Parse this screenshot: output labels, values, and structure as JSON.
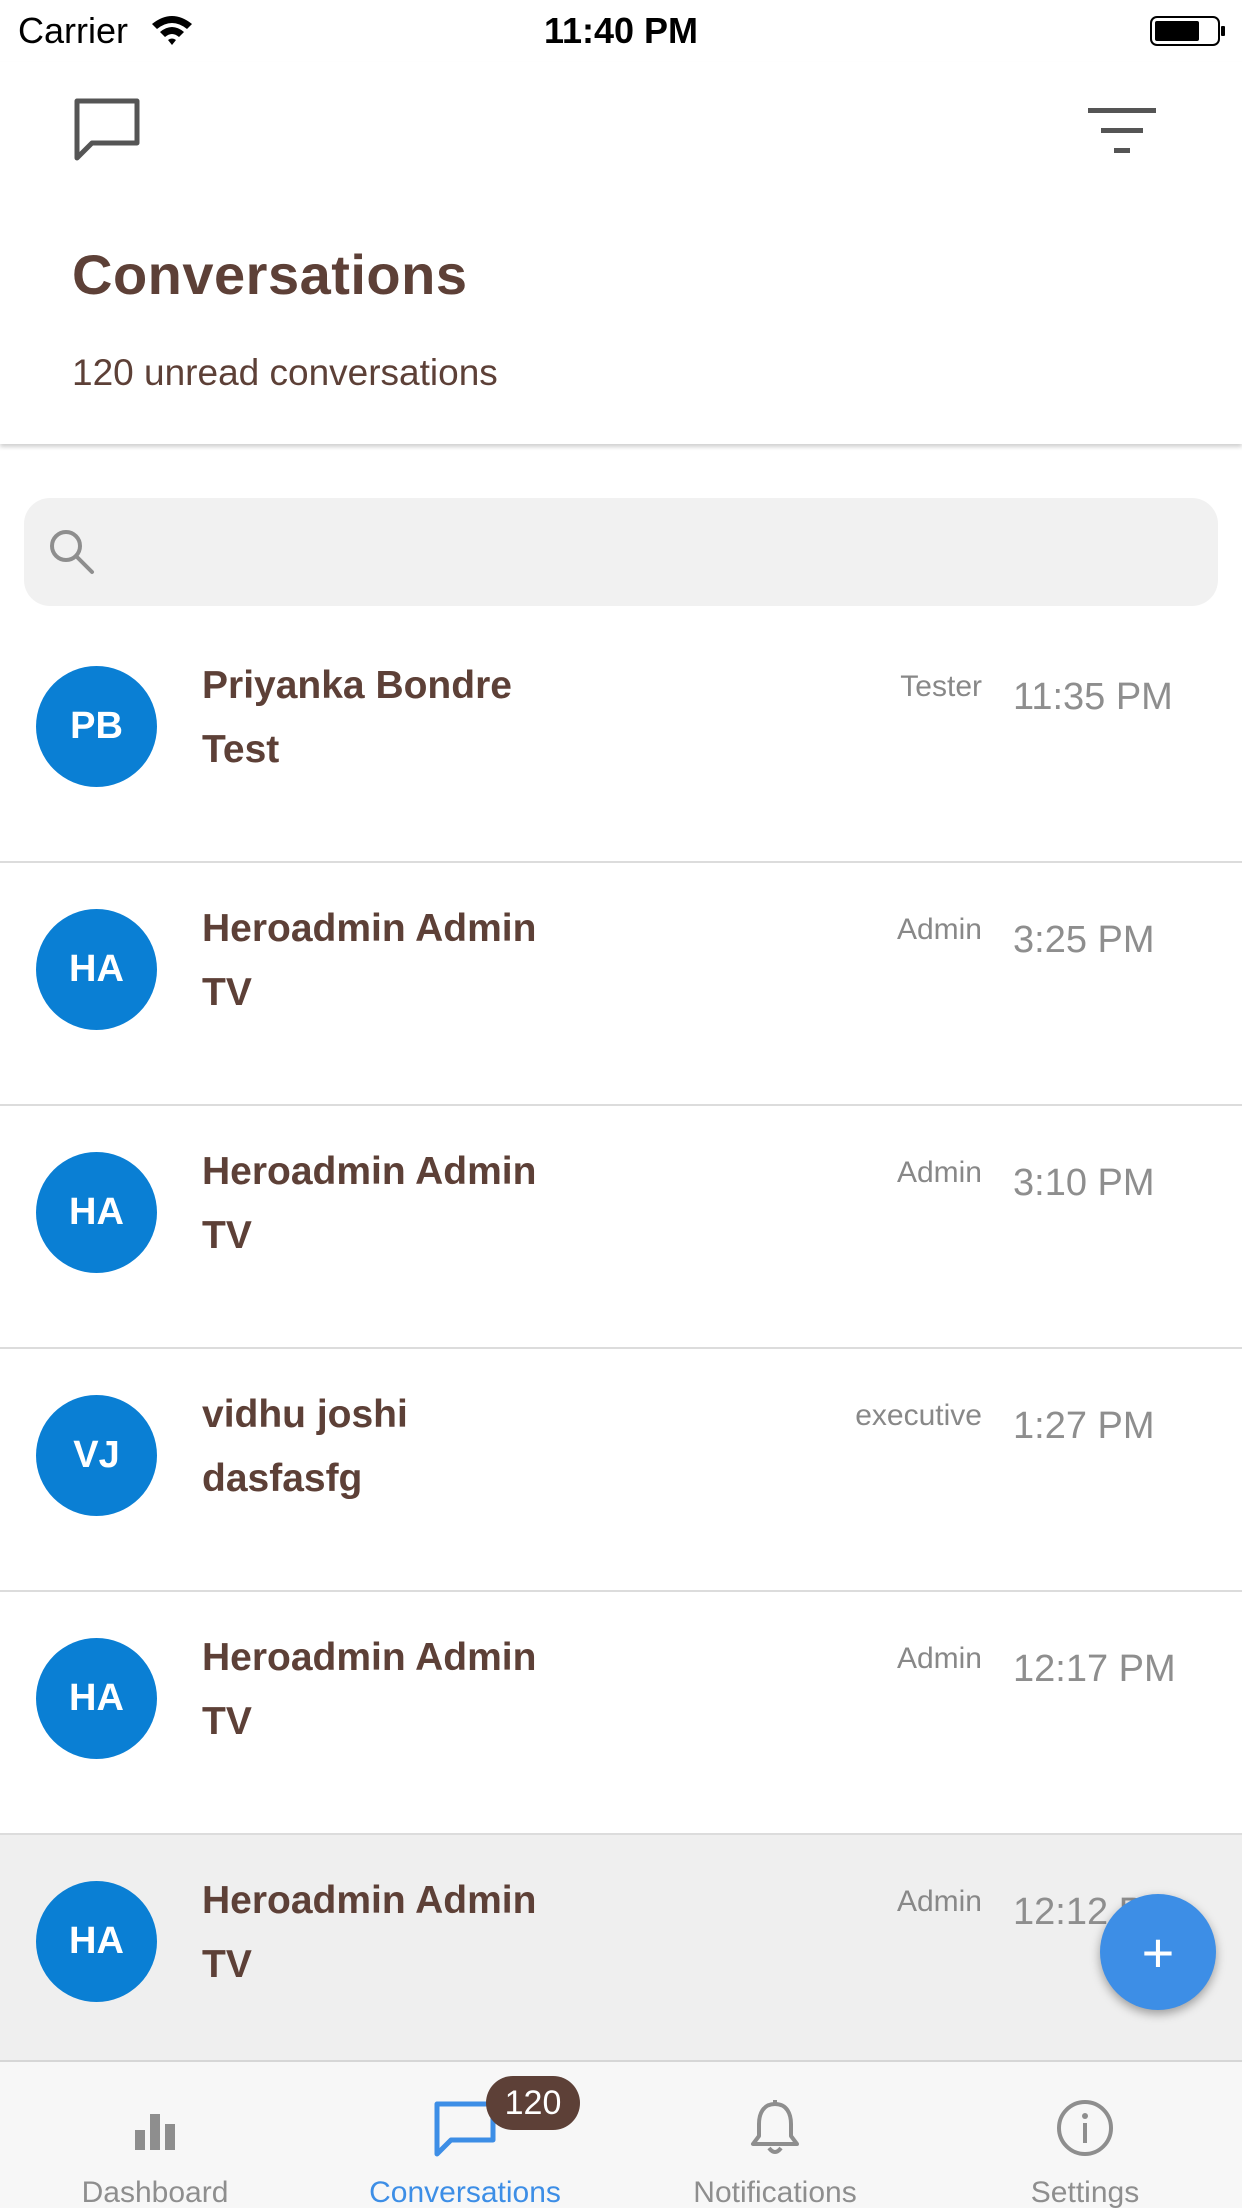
{
  "status_bar": {
    "carrier": "Carrier",
    "time": "11:40 PM"
  },
  "header": {
    "title": "Conversations",
    "subtitle": "120 unread conversations",
    "left_icon": "chat-bubble-icon",
    "right_icon": "filter-icon"
  },
  "search": {
    "placeholder": "",
    "value": ""
  },
  "conversations": [
    {
      "initials": "PB",
      "name": "Priyanka Bondre",
      "message": "Test",
      "role": "Tester",
      "time": "11:35 PM"
    },
    {
      "initials": "HA",
      "name": "Heroadmin Admin",
      "message": "TV",
      "role": "Admin",
      "time": "3:25 PM"
    },
    {
      "initials": "HA",
      "name": "Heroadmin Admin",
      "message": "TV",
      "role": "Admin",
      "time": "3:10 PM"
    },
    {
      "initials": "VJ",
      "name": "vidhu joshi",
      "message": "dasfasfg",
      "role": "executive",
      "time": "1:27 PM"
    },
    {
      "initials": "HA",
      "name": "Heroadmin Admin",
      "message": "TV",
      "role": "Admin",
      "time": "12:17 PM"
    },
    {
      "initials": "HA",
      "name": "Heroadmin Admin",
      "message": "TV",
      "role": "Admin",
      "time": "12:12 PM"
    }
  ],
  "fab": {
    "label": "+"
  },
  "tab_bar": {
    "tabs": [
      {
        "label": "Dashboard",
        "icon": "bar-chart-icon"
      },
      {
        "label": "Conversations",
        "icon": "chat-bubble-icon",
        "badge": "120"
      },
      {
        "label": "Notifications",
        "icon": "bell-icon"
      },
      {
        "label": "Settings",
        "icon": "info-icon"
      }
    ],
    "active": "Conversations"
  },
  "colors": {
    "brown": "#5d4037",
    "avatar_blue": "#0a7fd4",
    "accent_blue": "#3d8ee6"
  }
}
